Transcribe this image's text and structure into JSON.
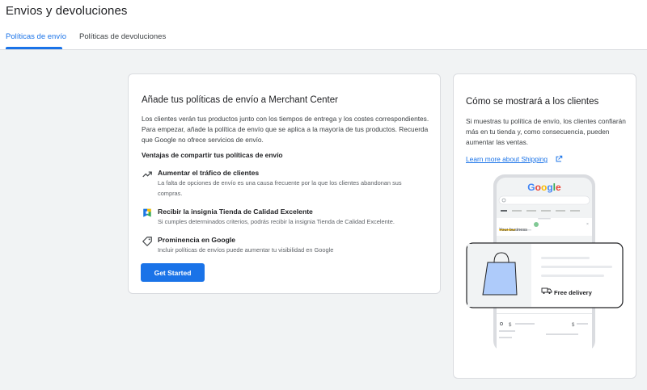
{
  "header": {
    "title": "Envios y devoluciones",
    "tabs": [
      {
        "label": "Políticas de envío",
        "active": true
      },
      {
        "label": "Políticas de devoluciones",
        "active": false
      }
    ]
  },
  "main_card": {
    "title": "Añade tus políticas de envío a Merchant Center",
    "description": "Los clientes verán tus productos junto con los tiempos de entrega y los costes correspondientes. Para empezar, añade la política de envío que se aplica a la mayoría de tus productos. Recuerda que Google no ofrece servicios de envío.",
    "benefits_title": "Ventajas de compartir tus políticas de envío",
    "benefits": [
      {
        "icon": "trending-up-icon",
        "title": "Aumentar el tráfico de clientes",
        "desc": "La falta de opciones de envío es una causa frecuente por la que los clientes abandonan sus compras."
      },
      {
        "icon": "badge-icon",
        "title": "Recibir la insignia Tienda de Calidad Excelente",
        "desc": "Si cumples determinados criterios, podrás recibir la insignia Tienda de Calidad Excelente."
      },
      {
        "icon": "tag-icon",
        "title": "Prominencia en Google",
        "desc": "Incluir políticas de envíos puede aumentar tu visibilidad en Google"
      }
    ],
    "cta_label": "Get Started"
  },
  "side_card": {
    "title": "Cómo se mostrará a los clientes",
    "description": "Si muestras tu política de envío, los clientes confiarán más en tu tienda y, como consecuencia, pueden aumentar las ventas.",
    "link_label": "Learn more about Shipping",
    "illustration": {
      "logo": "Google",
      "business_label": "Your business",
      "delivery_label": "Free delivery",
      "currency_symbol": "$"
    }
  },
  "colors": {
    "accent": "#1a73e8",
    "background": "#f1f3f4",
    "card_border": "#dadce0",
    "text_primary": "#202124",
    "text_secondary": "#5f6368"
  }
}
